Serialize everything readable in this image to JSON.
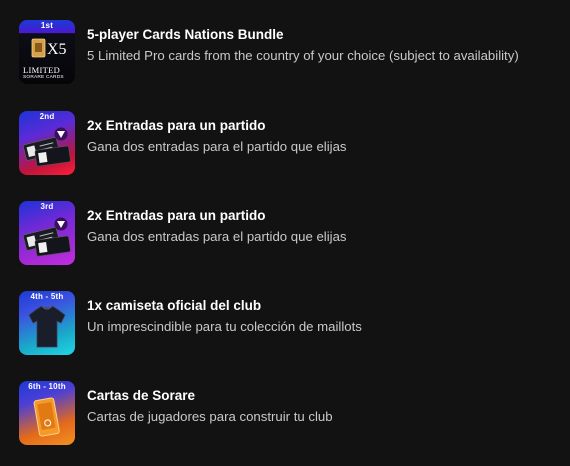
{
  "rewards": [
    {
      "rank": "1st",
      "title": "5-player Cards Nations Bundle",
      "description": "5 Limited Pro cards from the country of your choice (subject to availability)",
      "thumb_text": {
        "mult": "X5",
        "tier": "LIMITED",
        "brand": "SORARE CARDS"
      }
    },
    {
      "rank": "2nd",
      "title": "2x Entradas para un partido",
      "description": "Gana dos entradas para el partido que elijas"
    },
    {
      "rank": "3rd",
      "title": "2x Entradas para un partido",
      "description": "Gana dos entradas para el partido que elijas"
    },
    {
      "rank": "4th - 5th",
      "title": "1x camiseta oficial del club",
      "description": "Un imprescindible para tu colección de maillots"
    },
    {
      "rank": "6th - 10th",
      "title": "Cartas de Sorare",
      "description": "Cartas de jugadores para construir tu club"
    }
  ],
  "colors": {
    "background": "#121212",
    "title": "#ffffff",
    "description": "#c9c9c9"
  }
}
